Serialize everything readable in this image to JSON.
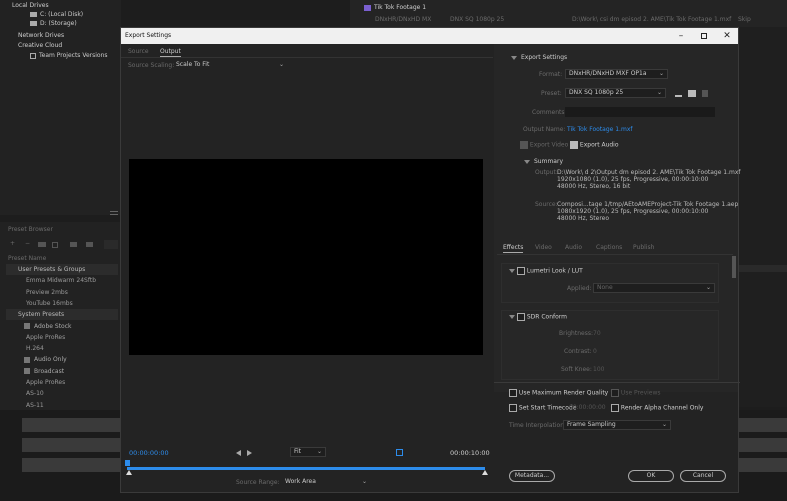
{
  "background_app": {
    "left_panel": {
      "local_drives": "Local Drives",
      "c_drive": "C: (Local Disk)",
      "d_drive": "D: (Storage)",
      "network_drives": "Network Drives",
      "creative_cloud": "Creative Cloud",
      "team_projects": "Team Projects Versions",
      "preset_browser": "Preset Browser",
      "preset_search": "Search",
      "preset_name_header": "Preset Name",
      "presets": [
        {
          "label": "User Presets & Groups",
          "type": "header"
        },
        {
          "label": "Emma Midwarm 24Sftb",
          "type": "item"
        },
        {
          "label": "Preview 2mbs",
          "type": "item"
        },
        {
          "label": "YouTube 16mbs",
          "type": "item"
        },
        {
          "label": "System Presets",
          "type": "header"
        },
        {
          "label": "Adobe Stock",
          "type": "group"
        },
        {
          "label": "Apple ProRes",
          "type": "item"
        },
        {
          "label": "H.264",
          "type": "item"
        },
        {
          "label": "Audio Only",
          "type": "group"
        },
        {
          "label": "Broadcast",
          "type": "group"
        },
        {
          "label": "Apple ProRes",
          "type": "item"
        },
        {
          "label": "AS-10",
          "type": "item"
        },
        {
          "label": "AS-11",
          "type": "item"
        }
      ]
    },
    "queue": {
      "item_title": "Tik Tok Footage 1",
      "format": "DNxHR/DNxHD MX",
      "preset": "DNX SQ 1080p 25",
      "output": "D:\\Work\\ csi dm episod 2. AME\\Tik Tok Footage 1.mxf",
      "status": "Skip"
    }
  },
  "dialog": {
    "title": "Export Settings",
    "tabs": [
      "Source",
      "Output"
    ],
    "active_tab": "Output",
    "source_scaling_label": "Source Scaling:",
    "source_scaling_value": "Scale To Fit",
    "export_settings": {
      "header": "Export Settings",
      "format_label": "Format:",
      "format_value": "DNxHR/DNxHD MXF OP1a",
      "preset_label": "Preset:",
      "preset_value": "DNX SQ 1080p 25",
      "comments_label": "Comments:",
      "output_name_label": "Output Name:",
      "output_name_value": "Tik Tok Footage 1.mxf",
      "export_video_label": "Export Video",
      "export_audio_label": "Export Audio",
      "summary_header": "Summary",
      "summary_output_label": "Output:",
      "summary_output_lines": [
        "D:\\Work\\ d 2\\Output dm episod 2. AME\\Tik Tok Footage 1.mxf",
        "1920x1080 (1.0), 25 fps, Progressive, 00:00:10:00",
        "48000 Hz, Stereo, 16 bit"
      ],
      "summary_source_label": "Source:",
      "summary_source_lines": [
        "Composi...tage 1/tmp/AEtoAMEProject-Tik Tok Footage 1.aep",
        "1080x1920 (1.0), 25 fps, Progressive, 00:00:10:00",
        "48000 Hz, Stereo"
      ]
    },
    "settings_tabs": [
      "Effects",
      "Video",
      "Audio",
      "Captions",
      "Publish"
    ],
    "active_settings_tab": "Effects",
    "effects": {
      "lumetri_label": "Lumetri Look / LUT",
      "applied_label": "Applied:",
      "applied_value": "None",
      "sdr_label": "SDR Conform",
      "brightness_label": "Brightness:",
      "brightness_value": "70",
      "contrast_label": "Contrast:",
      "contrast_value": "0",
      "soft_knee_label": "Soft Knee:",
      "soft_knee_value": "100"
    },
    "bottom_options": {
      "max_render_quality": "Use Maximum Render Quality",
      "use_previews": "Use Previews",
      "set_start_timecode": "Set Start Timecode",
      "start_timecode_value": "00:00:00:00",
      "render_alpha": "Render Alpha Channel Only",
      "time_interpolation_label": "Time Interpolation:",
      "time_interpolation_value": "Frame Sampling"
    },
    "buttons": {
      "metadata": "Metadata...",
      "ok": "OK",
      "cancel": "Cancel"
    },
    "timeline": {
      "current_time": "00:00:00:00",
      "end_time": "00:00:10:00",
      "fit_label": "Fit",
      "source_range_label": "Source Range:",
      "source_range_value": "Work Area",
      "playhead_fraction": 0.0
    }
  },
  "colors": {
    "accent_blue": "#2d8ceb",
    "titlebar": "#f0f0f0",
    "dialog_bg": "#232323"
  }
}
